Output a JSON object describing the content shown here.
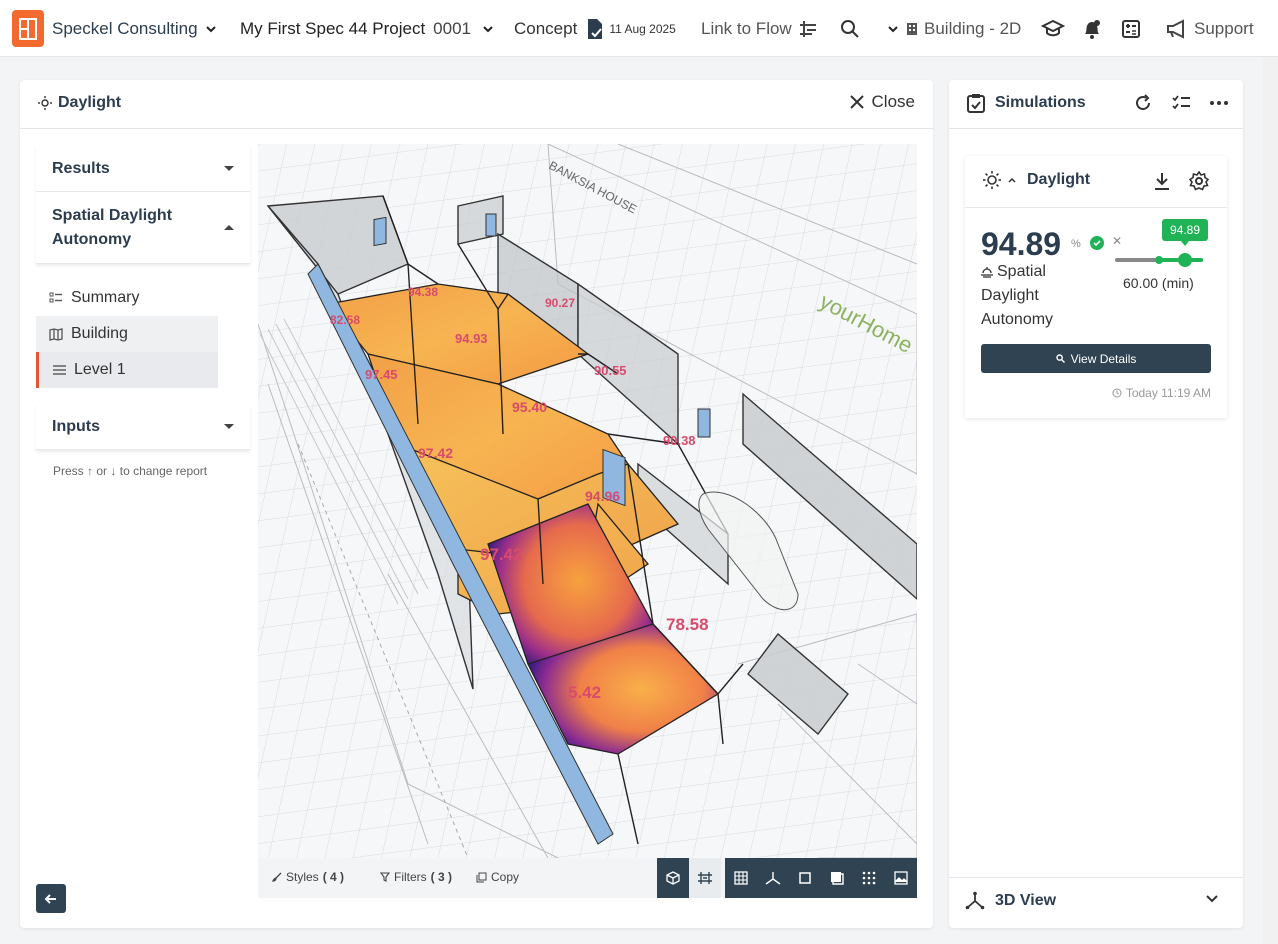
{
  "topbar": {
    "company": "Speckel Consulting",
    "project_name": "My First Spec 44 Project",
    "project_number": "0001",
    "stage": "Concept",
    "stage_date": "11 Aug 2025",
    "link_to_flow": "Link to Flow",
    "view_mode": "Building - 2D",
    "support": "Support",
    "accent_color": "#f26a2e"
  },
  "main_panel": {
    "title": "Daylight",
    "close_label": "Close",
    "side": {
      "results": "Results",
      "sda": "Spatial Daylight Autonomy",
      "items": [
        "Summary",
        "Building",
        "Level 1"
      ],
      "inputs": "Inputs",
      "hint_press": "Press",
      "hint_or": "or",
      "hint_change": "to change report"
    },
    "viewport": {
      "room_values": [
        "94.38",
        "90.27",
        "82.58",
        "94.93",
        "97.45",
        "90.55",
        "95.40",
        "90.38",
        "97.42",
        "94.96",
        "97.42",
        "78.58",
        "5.42"
      ],
      "sign_text": "yourHome",
      "plan_title": "BANKSIA HOUSE"
    },
    "toolbar": {
      "styles": "Styles",
      "styles_count": "( 4 )",
      "filters": "Filters",
      "filters_count": "( 3 )",
      "copy": "Copy"
    }
  },
  "sim_panel": {
    "title": "Simulations",
    "card": {
      "label": "Daylight",
      "value": "94.89",
      "unit": "%",
      "metric_name": "Spatial Daylight Autonomy",
      "slider_value": "94.89",
      "minimum": "60.00 (min)",
      "view_details": "View Details",
      "timestamp": "Today 11:19 AM",
      "pass_color": "#1fb356"
    },
    "view3d": "3D View"
  }
}
